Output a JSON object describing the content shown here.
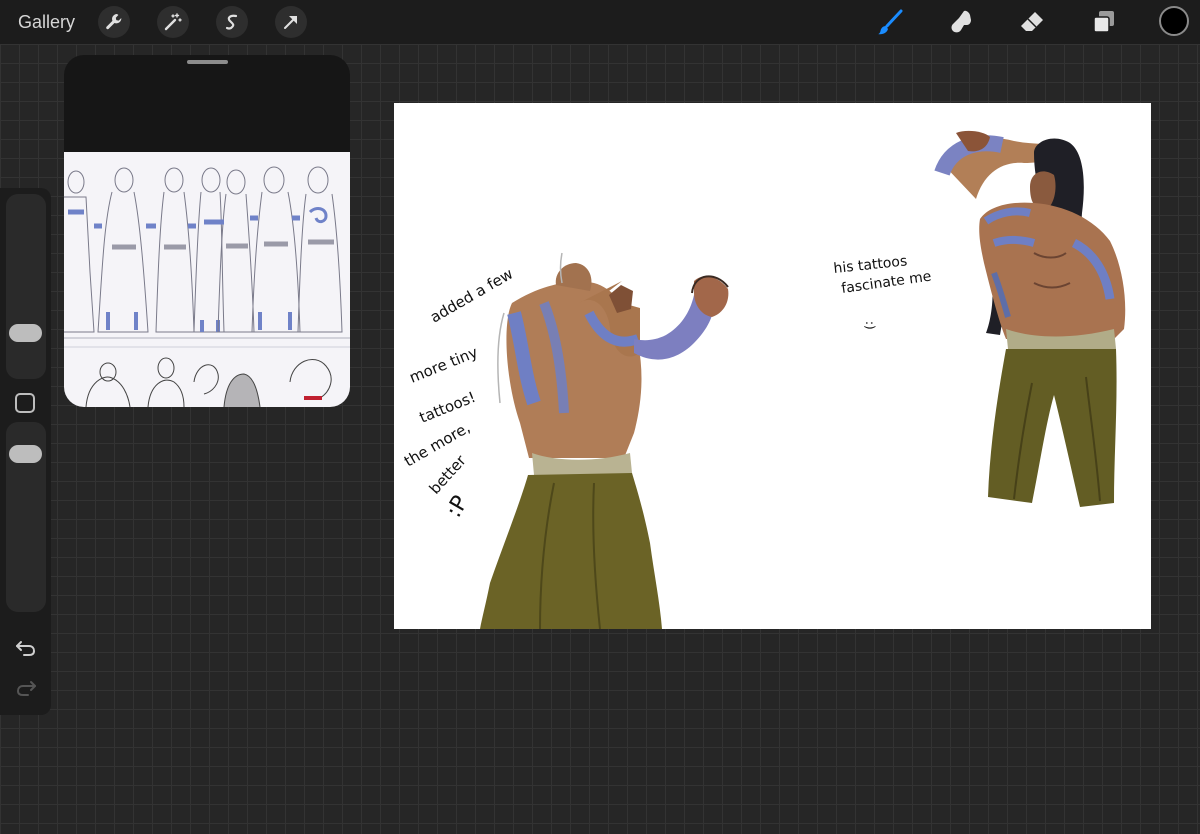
{
  "topbar": {
    "gallery_label": "Gallery",
    "left_tools": [
      "wrench-icon",
      "magic-wand-icon",
      "selection-icon",
      "transform-arrow-icon"
    ],
    "right_tools": [
      "brush-icon",
      "smudge-icon",
      "eraser-icon",
      "layers-icon"
    ],
    "active_tool": "brush-icon",
    "accent_color": "#1a8cff",
    "current_color": "#000000"
  },
  "sidebar": {
    "brush_size_slider": "slider",
    "modify_button": "square",
    "opacity_slider": "slider",
    "undo": "undo-arrow-icon",
    "redo": "redo-arrow-icon"
  },
  "reference_panel": {
    "content": "character turnaround sketches"
  },
  "canvas": {
    "note_left": [
      "added a few",
      "more tiny",
      "tattoos!",
      "the more,",
      "better",
      ":P"
    ],
    "note_right": [
      "his tattoos",
      "fascinate me",
      ":)"
    ]
  }
}
